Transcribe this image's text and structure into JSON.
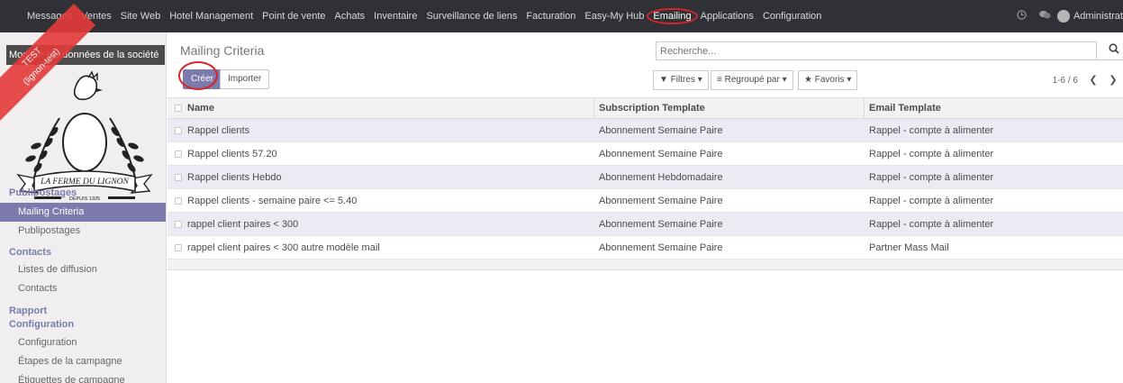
{
  "topbar": {
    "menu": [
      "Messages",
      "Ventes",
      "Site Web",
      "Hotel Management",
      "Point de vente",
      "Achats",
      "Inventaire",
      "Surveillance de liens",
      "Facturation",
      "Easy-My Hub",
      "Emailing",
      "Applications",
      "Configuration"
    ],
    "active": "Emailing",
    "user": "Administrat",
    "icons": [
      "clock-icon",
      "chat-icon"
    ]
  },
  "ribbon": {
    "line1": "TEST",
    "line2": "(lignon-test)"
  },
  "sidebar": {
    "company": "Modifier les données de la société",
    "logo": {
      "text": "LA FERME DU LIGNON",
      "subtext": "DEPUIS 1925"
    },
    "sections": [
      {
        "title": "Publipostages",
        "items": [
          "Mailing Criteria",
          "Publipostages"
        ]
      },
      {
        "title": "Contacts",
        "items": [
          "Listes de diffusion",
          "Contacts"
        ]
      },
      {
        "title": "Rapport",
        "items": []
      },
      {
        "title": "Configuration",
        "items": [
          "Configuration",
          "Étapes de la campagne",
          "Étiquettes de campagne"
        ]
      }
    ],
    "active_item": "Mailing Criteria"
  },
  "cp": {
    "title": "Mailing Criteria",
    "create": "Créer",
    "import": "Importer",
    "search_placeholder": "Recherche...",
    "filters": "Filtres",
    "groupby": "Regroupé par",
    "favorites": "Favoris",
    "pager": "1-6 / 6"
  },
  "table": {
    "columns": [
      "Name",
      "Subscription Template",
      "Email Template"
    ],
    "rows": [
      [
        "Rappel clients",
        "Abonnement Semaine Paire",
        "Rappel - compte à alimenter"
      ],
      [
        "Rappel clients 57.20",
        "Abonnement Semaine Paire",
        "Rappel - compte à alimenter"
      ],
      [
        "Rappel clients Hebdo",
        "Abonnement Hebdomadaire",
        "Rappel - compte à alimenter"
      ],
      [
        "Rappel clients - semaine paire <= 5.40",
        "Abonnement Semaine Paire",
        "Rappel - compte à alimenter"
      ],
      [
        "rappel client paires < 300",
        "Abonnement Semaine Paire",
        "Rappel - compte à alimenter"
      ],
      [
        "rappel client paires < 300 autre modèle mail",
        "Abonnement Semaine Paire",
        "Partner Mass Mail"
      ]
    ]
  },
  "colors": {
    "topbar": "#2f3136",
    "accent": "#7c7bad",
    "annotation": "#d8232a",
    "ribbon": "#e53a3a"
  }
}
